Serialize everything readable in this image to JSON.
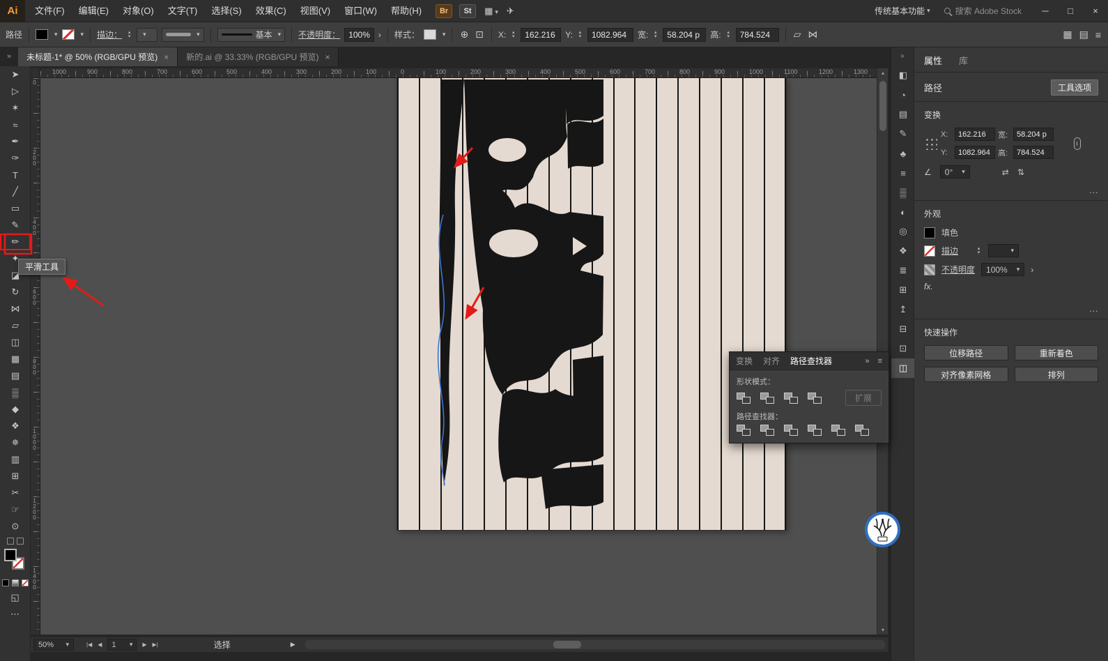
{
  "icons": {
    "caret": "▾",
    "up": "▴",
    "chev_r": "»",
    "menu": "≡",
    "grid": "▦",
    "panel": "▤",
    "doc": "⊡",
    "share": "✈",
    "globe": "⊕",
    "more": "›",
    "angle": "∠",
    "flip_h": "⇄",
    "flip_v": "⇅",
    "dots": "···",
    "ellipsis": "⋯",
    "screen": "◱",
    "nav_first": "|◀",
    "nav_prev": "◀",
    "nav_next": "▶",
    "nav_last": "▶|",
    "transform_a": "▱",
    "transform_b": "⋈"
  },
  "titlebar": {
    "logo": "Ai",
    "menus": [
      "文件(F)",
      "编辑(E)",
      "对象(O)",
      "文字(T)",
      "选择(S)",
      "效果(C)",
      "视图(V)",
      "窗口(W)",
      "帮助(H)"
    ],
    "bridge": "Br",
    "stock": "St",
    "workspace": "传统基本功能",
    "search": "搜索 Adobe Stock",
    "window": {
      "min": "─",
      "max": "□",
      "close": "×"
    }
  },
  "controlbar": {
    "target": "路径",
    "stroke_label": "描边：",
    "brush": "基本",
    "opacity_label": "不透明度：",
    "opacity": "100%",
    "style_label": "样式：",
    "x_label": "X:",
    "x": "162.216",
    "y_label": "Y:",
    "y": "1082.964",
    "w_label": "宽:",
    "w": "58.204 p",
    "h_label": "高:",
    "h": "784.524"
  },
  "tabs": [
    {
      "title": "未标题-1* @ 50% (RGB/GPU 预览)",
      "close": "×"
    },
    {
      "title": "新的.ai @ 33.33% (RGB/GPU 预览)",
      "close": "×"
    }
  ],
  "ruler_h": [
    "1000",
    "900",
    "800",
    "700",
    "600",
    "500",
    "400",
    "300",
    "200",
    "100",
    "0",
    "100",
    "200",
    "300",
    "400",
    "500",
    "600",
    "700",
    "800",
    "900",
    "1000",
    "1100",
    "1200",
    "1300"
  ],
  "ruler_v": [
    "0",
    "200",
    "400",
    "600",
    "800",
    "1000",
    "1200",
    "1400"
  ],
  "tools": [
    {
      "name": "selection",
      "glyph": "➤"
    },
    {
      "name": "direct-selection",
      "glyph": "▷"
    },
    {
      "name": "magic-wand",
      "glyph": "✶"
    },
    {
      "name": "lasso",
      "glyph": "≈"
    },
    {
      "name": "pen",
      "glyph": "✒"
    },
    {
      "name": "curvature",
      "glyph": "✑"
    },
    {
      "name": "type",
      "glyph": "T"
    },
    {
      "name": "line-segment",
      "glyph": "╱"
    },
    {
      "name": "rectangle",
      "glyph": "▭"
    },
    {
      "name": "paintbrush",
      "glyph": "✎"
    },
    {
      "name": "pencil",
      "glyph": "✏"
    },
    {
      "name": "shaper",
      "glyph": "✦"
    },
    {
      "name": "eraser",
      "glyph": "◪"
    },
    {
      "name": "rotate",
      "glyph": "↻"
    },
    {
      "name": "width",
      "glyph": "⋈"
    },
    {
      "name": "free-transform",
      "glyph": "▱"
    },
    {
      "name": "shape-builder",
      "glyph": "◫"
    },
    {
      "name": "perspective-grid",
      "glyph": "▦"
    },
    {
      "name": "mesh",
      "glyph": "▤"
    },
    {
      "name": "gradient",
      "glyph": "▒"
    },
    {
      "name": "eyedropper",
      "glyph": "◆"
    },
    {
      "name": "blend",
      "glyph": "❖"
    },
    {
      "name": "symbol-sprayer",
      "glyph": "✵"
    },
    {
      "name": "column-graph",
      "glyph": "▥"
    },
    {
      "name": "artboard",
      "glyph": "⊞"
    },
    {
      "name": "slice",
      "glyph": "✂"
    },
    {
      "name": "hand",
      "glyph": "☞"
    },
    {
      "name": "zoom",
      "glyph": "⊙"
    }
  ],
  "tooltip": "平滑工具",
  "dock_icons": [
    {
      "name": "color",
      "glyph": "◧"
    },
    {
      "name": "color-guide",
      "glyph": "◔"
    },
    {
      "name": "swatches",
      "glyph": "▤"
    },
    {
      "name": "brushes",
      "glyph": "✎"
    },
    {
      "name": "symbols",
      "glyph": "♣"
    },
    {
      "name": "stroke",
      "glyph": "≡"
    },
    {
      "name": "gradient",
      "glyph": "▒"
    },
    {
      "name": "transparency",
      "glyph": "◐"
    },
    {
      "name": "appearance",
      "glyph": "◎"
    },
    {
      "name": "graphic-styles",
      "glyph": "❖"
    },
    {
      "name": "layers",
      "glyph": "≣"
    },
    {
      "name": "artboards",
      "glyph": "⊞"
    },
    {
      "name": "asset-export",
      "glyph": "↥"
    },
    {
      "name": "align",
      "glyph": "⊟"
    },
    {
      "name": "transform",
      "glyph": "⊡"
    },
    {
      "name": "pathfinder",
      "glyph": "◫"
    }
  ],
  "pathfinder": {
    "tabs": [
      "变换",
      "对齐",
      "路径查找器"
    ],
    "shape_mode_label": "形状模式：",
    "expand_button": "扩展",
    "finder_label": "路径查找器："
  },
  "properties": {
    "tabs": [
      "属性",
      "库"
    ],
    "target": "路径",
    "tool_options": "工具选项",
    "transform": {
      "title": "变换",
      "x_label": "X:",
      "x": "162.216",
      "y_label": "Y:",
      "y": "1082.964",
      "w_label": "宽:",
      "w": "58.204 p",
      "h_label": "高:",
      "h": "784.524",
      "angle_value": "0°"
    },
    "appearance": {
      "title": "外观",
      "fill_label": "填色",
      "stroke_label": "描边",
      "opacity_label": "不透明度",
      "opacity_value": "100%",
      "fx": "fx."
    },
    "quick": {
      "title": "快速操作",
      "buttons": [
        "位移路径",
        "重新着色",
        "对齐像素网格",
        "排列"
      ]
    }
  },
  "statusbar": {
    "zoom": "50%",
    "page": "1",
    "status": "选择"
  },
  "colors": {
    "accent_red": "#e31b18",
    "artboard_beige": "#e5dad1",
    "selection_blue": "#3a76d8",
    "logo_orange": "#ff9a2a"
  }
}
